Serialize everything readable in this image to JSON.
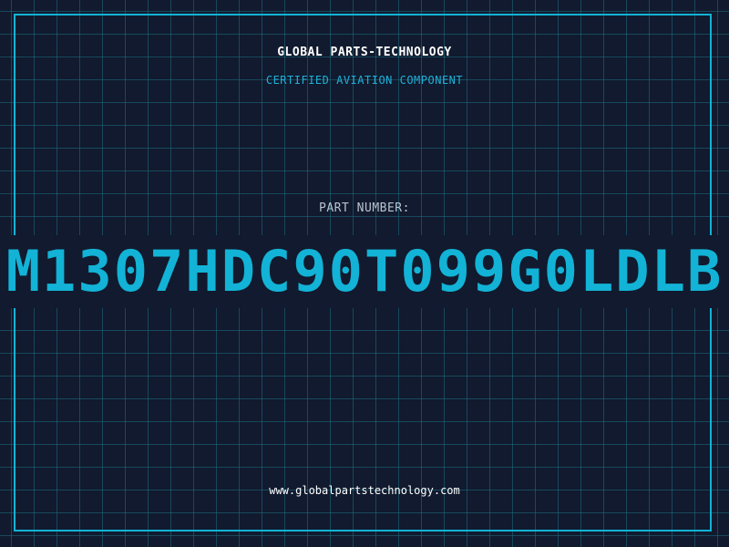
{
  "header": {
    "company": "GLOBAL PARTS-TECHNOLOGY",
    "tagline": "CERTIFIED AVIATION COMPONENT"
  },
  "part": {
    "label": "PART NUMBER:",
    "number": "M1307HDC90T099G0LDLB"
  },
  "footer": {
    "website": "www.globalpartstechnology.com"
  },
  "colors": {
    "background": "#111a2e",
    "grid": "#1e6e82",
    "accent": "#12b3d6",
    "heading": "#ffffff",
    "label": "#b8c4d0"
  }
}
